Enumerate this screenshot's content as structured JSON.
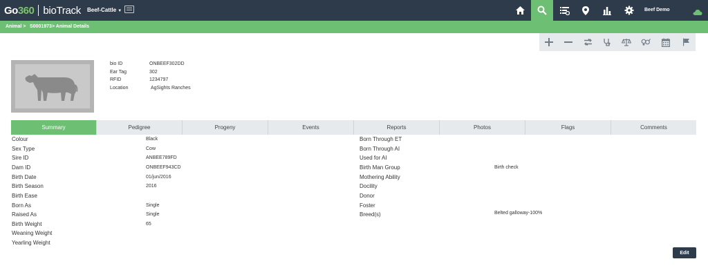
{
  "header": {
    "logo_go": "Go",
    "logo_360": "360",
    "logo_product": "bioTrack",
    "species": "Beef-Cattle",
    "user": "Beef Demo",
    "nav_icons": [
      "home-icon",
      "search-icon",
      "list-settings-icon",
      "map-pin-icon",
      "bar-chart-icon",
      "gear-icon"
    ],
    "active_icon": "search-icon",
    "accent": "#6dbf74",
    "bar_color": "#2e3b4a"
  },
  "breadcrumb": {
    "item1": "Animal >",
    "item2": "S0001973",
    "item3": "> Animal Details"
  },
  "actions": [
    "add-icon",
    "remove-icon",
    "transfer-icon",
    "stethoscope-icon",
    "scale-icon",
    "breeding-icon",
    "calendar-icon",
    "flag-icon"
  ],
  "animal": {
    "labels": {
      "bio_id": "bio ID",
      "ear_tag": "Ear Tag",
      "rfid": "RFID",
      "location": "Location"
    },
    "values": {
      "bio_id": "ONBEEF302DD",
      "ear_tag": "302",
      "rfid": "1234797",
      "location": "AgSights Ranches"
    }
  },
  "tabs": [
    "Summary",
    "Pedigree",
    "Progeny",
    "Events",
    "Reports",
    "Photos",
    "Flags",
    "Comments"
  ],
  "active_tab": "Summary",
  "summary_left": [
    {
      "label": "Colour",
      "value": "Black"
    },
    {
      "label": "Sex Type",
      "value": "Cow"
    },
    {
      "label": "Sire ID",
      "value": "ANBEE789FD"
    },
    {
      "label": "Dam ID",
      "value": "ONBEEF943CD"
    },
    {
      "label": "Birth Date",
      "value": "01/jun/2016"
    },
    {
      "label": "Birth Season",
      "value": "2016"
    },
    {
      "label": "Birth Ease",
      "value": ""
    },
    {
      "label": "Born As",
      "value": "Single"
    },
    {
      "label": "Raised As",
      "value": "Single"
    },
    {
      "label": "Birth Weight",
      "value": "65"
    },
    {
      "label": "Weaning Weight",
      "value": ""
    },
    {
      "label": "Yearling Weight",
      "value": ""
    }
  ],
  "summary_right": [
    {
      "label": "Born Through ET",
      "value": ""
    },
    {
      "label": "Born Through AI",
      "value": ""
    },
    {
      "label": "Used for AI",
      "value": ""
    },
    {
      "label": "Birth Man Group",
      "value": "Birth check"
    },
    {
      "label": "Mothering Ability",
      "value": ""
    },
    {
      "label": "Docility",
      "value": ""
    },
    {
      "label": "Donor",
      "value": ""
    },
    {
      "label": "Foster",
      "value": ""
    },
    {
      "label": "Breed(s)",
      "value": "Belted galloway-100%"
    }
  ],
  "edit_label": "Edit"
}
